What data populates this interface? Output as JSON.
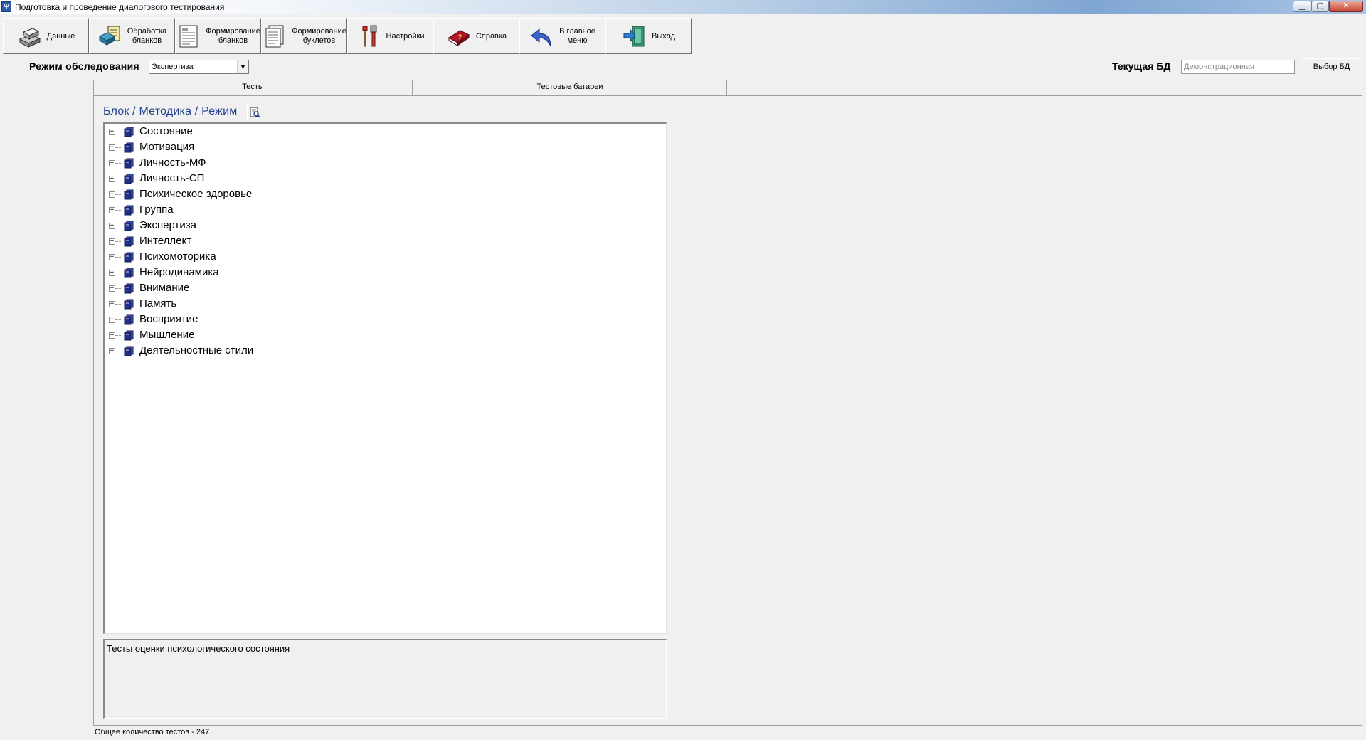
{
  "window": {
    "title": "Подготовка и проведение диалогового тестирования",
    "min_glyph": "▁",
    "max_glyph": "▢",
    "close_glyph": "✕"
  },
  "toolbar": {
    "buttons": [
      {
        "label": "Данные",
        "icon": "data-file-icon"
      },
      {
        "label": "Обработка\nбланков",
        "icon": "process-forms-icon"
      },
      {
        "label": "Формирование\nбланков",
        "icon": "form-sheet-icon"
      },
      {
        "label": "Формирование\nбуклетов",
        "icon": "booklet-icon"
      },
      {
        "label": "Настройки",
        "icon": "tools-icon"
      },
      {
        "label": "Справка",
        "icon": "help-book-icon"
      },
      {
        "label": "В главное\nменю",
        "icon": "back-arrow-icon"
      },
      {
        "label": "Выход",
        "icon": "exit-door-icon"
      }
    ]
  },
  "mode": {
    "label": "Режим обследования",
    "value": "Экспертиза",
    "arrow": "▼"
  },
  "database": {
    "label": "Текущая БД",
    "placeholder": "Демонстрационная",
    "button": "Выбор БД"
  },
  "tabs": [
    {
      "label": "Тесты"
    },
    {
      "label": "Тестовые батареи"
    }
  ],
  "tree": {
    "header": "Блок / Методика / Режим",
    "expander": "+",
    "items": [
      "Состояние",
      "Мотивация",
      "Личность-МФ",
      "Личность-СП",
      "Психическое здоровье",
      "Группа",
      "Экспертиза",
      "Интеллект",
      "Психомоторика",
      "Нейродинамика",
      "Внимание",
      "Память",
      "Восприятие",
      "Мышление",
      "Деятельностные стили"
    ]
  },
  "description": "Тесты оценки психологического состояния",
  "status": "Общее количество тестов - 247",
  "colors": {
    "tree_header": "#1f3f8f",
    "folder": "#1f2f8c"
  }
}
